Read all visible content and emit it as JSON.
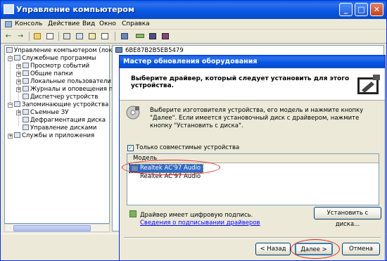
{
  "main_window": {
    "title": "Управление компьютером",
    "controls": {
      "minimize": "_",
      "maximize": "□",
      "close": "✕"
    }
  },
  "menu": [
    "Консоль",
    "Действие",
    "Вид",
    "Окно",
    "Справка"
  ],
  "toolbar": {
    "back": "←",
    "forward": "→"
  },
  "tree": {
    "root": "Управление компьютером (локаль",
    "items": [
      "Служебные программы",
      "Просмотр событий",
      "Общие папки",
      "Локальные пользователи",
      "Журналы и оповещения пр",
      "Диспетчер устройств",
      "Запоминающие устройства",
      "Съемные ЗУ",
      "Дефрагментация диска",
      "Управление дисками",
      "Службы и приложения"
    ]
  },
  "right_pane": {
    "device_id": "6BE87B2B5EB5479"
  },
  "dialog": {
    "title": "Мастер обновления оборудования",
    "header": "Выберите драйвер, который следует установить для этого устройства.",
    "description": "Выберите изготовителя устройства, его модель и нажмите кнопку \"Далее\". Если имеется установочный диск с драйвером, нажмите кнопку \"Установить с диска\".",
    "compatible_checkbox": "Только совместимые устройства",
    "compatible_checked": true,
    "check_mark": "✓",
    "list_header": "Модель",
    "models": [
      "Realtek AC'97 Audio",
      "Realtek AC'97 Audio"
    ],
    "signed_text": "Драйвер имеет цифровую подпись.",
    "signing_link": "Сведения о подписывании драйверов",
    "buttons": {
      "have_disk": "Установить с диска...",
      "back": "< Назад",
      "next": "Далее >",
      "cancel": "Отмена"
    }
  }
}
